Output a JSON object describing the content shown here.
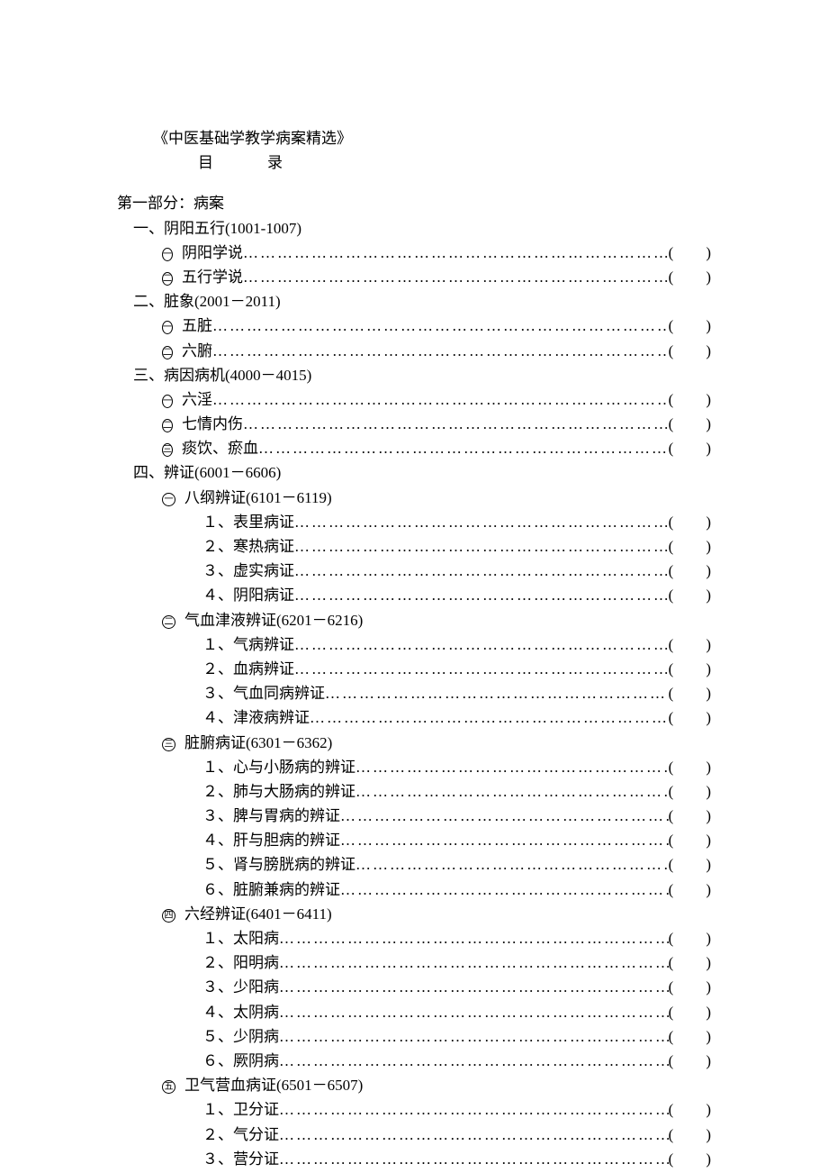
{
  "book_title": "《中医基础学教学病案精选》",
  "mulu": "目录",
  "part1": "第一部分：病案",
  "s1": {
    "header": "一、阴阳五行(1001-1007)",
    "i1": {
      "mark": "一",
      "label": "阴阳学说"
    },
    "i2": {
      "mark": "二",
      "label": "五行学说"
    }
  },
  "s2": {
    "header": "二、脏象(2001－2011)",
    "i1": {
      "mark": "一",
      "label": "五脏"
    },
    "i2": {
      "mark": "二",
      "label": "六腑"
    }
  },
  "s3": {
    "header": "三、病因病机(4000－4015)",
    "i1": {
      "mark": "一",
      "label": "六淫"
    },
    "i2": {
      "mark": "二",
      "label": "七情内伤"
    },
    "i3": {
      "mark": "三",
      "label": "痰饮、瘀血"
    }
  },
  "s4": {
    "header": "四、辨证(6001－6606)",
    "g1": {
      "mark": "一",
      "header": "八纲辨证(6101－6119)",
      "i1": "１、表里病证",
      "i2": "２、寒热病证",
      "i3": "３、虚实病证",
      "i4": "４、阴阳病证"
    },
    "g2": {
      "mark": "二",
      "header": "气血津液辨证(6201－6216)",
      "i1": "１、气病辨证",
      "i2": "２、血病辨证",
      "i3": "３、气血同病辨证",
      "i4": "４、津液病辨证"
    },
    "g3": {
      "mark": "三",
      "header": "脏腑病证(6301－6362)",
      "i1": "１、心与小肠病的辨证",
      "i2": "２、肺与大肠病的辨证",
      "i3": "３、脾与胃病的辨证",
      "i4": "４、肝与胆病的辨证",
      "i5": "５、肾与膀胱病的辨证",
      "i6": "６、脏腑兼病的辨证"
    },
    "g4": {
      "mark": "四",
      "header": "六经辨证(6401－6411)",
      "i1": "１、太阳病",
      "i2": "２、阳明病",
      "i3": "３、少阳病",
      "i4": "４、太阴病",
      "i5": "５、少阴病",
      "i6": "６、厥阴病"
    },
    "g5": {
      "mark": "五",
      "header": "卫气营血病证(6501－6507)",
      "i1": "１、卫分证",
      "i2": "２、气分证",
      "i3": "３、营分证"
    }
  },
  "paren_l": "(",
  "paren_r": ")",
  "dots": "……………………………………………………………………………………………………"
}
